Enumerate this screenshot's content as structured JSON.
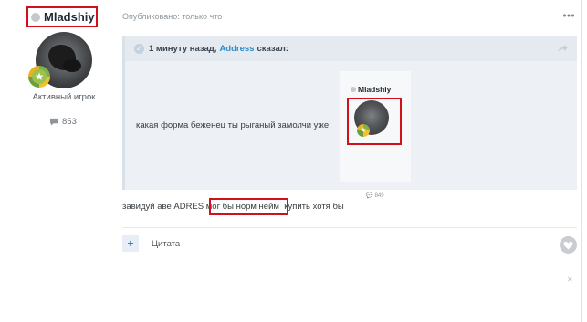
{
  "post": {
    "author": "Mladshiy",
    "member_group": "Активный игрок",
    "post_count": "853",
    "published": "Опубликовано: только что",
    "body": "завидуй аве ADRES мог бы норм нейм  купить хотя бы"
  },
  "quote": {
    "time": "1 минуту назад,",
    "user": "Address",
    "said": "сказал:",
    "text": "какая форма беженец ты рыганый замолчи уже",
    "embed": {
      "author": "Mladshiy",
      "post_count": "849"
    }
  },
  "actions": {
    "quote_label": "Цитата",
    "plus": "+"
  },
  "icons": {
    "more": "ellipsis-icon",
    "share": "share-arrow-icon",
    "like": "heart-icon",
    "comment": "speech-bubble-icon",
    "close": "close-icon"
  },
  "colors": {
    "highlight": "#d0111b",
    "link": "#2d8bc9"
  }
}
